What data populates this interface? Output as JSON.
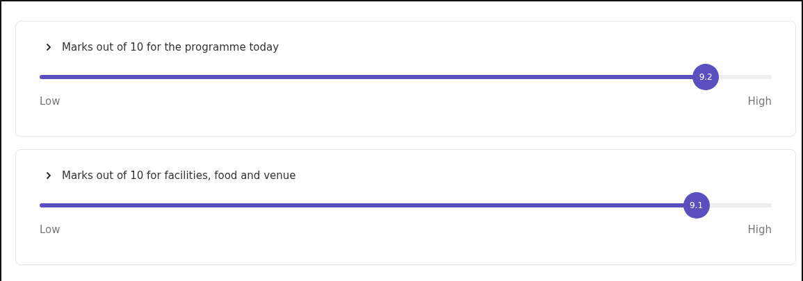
{
  "questions": [
    {
      "title": "Marks out of 10 for the programme today",
      "level": 0.91,
      "reading": "9.2",
      "min_label": "Low",
      "max_label": "High"
    },
    {
      "title": "Marks out of 10 for facilities, food and venue",
      "level": 0.897,
      "reading": "9.1",
      "min_label": "Low",
      "max_label": "High"
    }
  ]
}
